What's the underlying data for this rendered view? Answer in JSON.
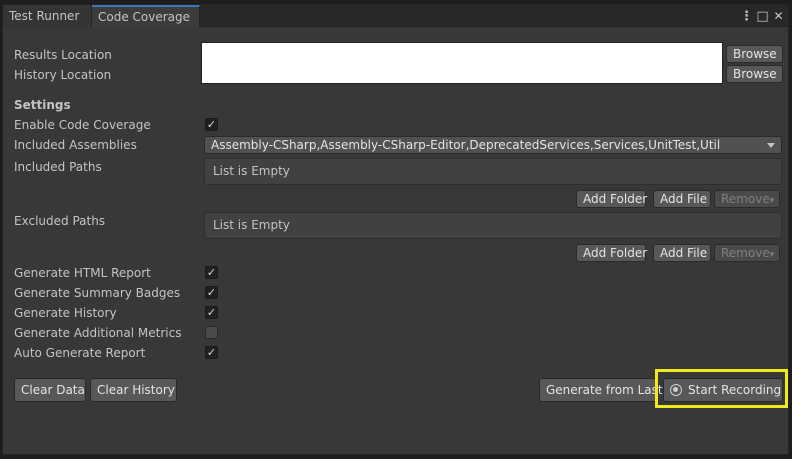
{
  "tabs": [
    {
      "label": "Test Runner",
      "active": false
    },
    {
      "label": "Code Coverage",
      "active": true
    }
  ],
  "window_controls": {
    "menu_icon": "kebab-menu-icon",
    "maximize_icon": "maximize-icon",
    "close_icon": "close-icon",
    "close_glyph": "✕",
    "maximize_glyph": "□",
    "menu_glyph": "⋮"
  },
  "locations": {
    "results_label": "Results Location",
    "history_label": "History Location",
    "browse_label": "Browse",
    "results_value": "",
    "history_value": ""
  },
  "settings": {
    "heading": "Settings",
    "enable_code_coverage_label": "Enable Code Coverage",
    "enable_code_coverage": true,
    "included_assemblies_label": "Included Assemblies",
    "included_assemblies_value": "Assembly-CSharp,Assembly-CSharp-Editor,DeprecatedServices,Services,UnitTest,Util",
    "included_paths_label": "Included Paths",
    "excluded_paths_label": "Excluded Paths",
    "list_empty_text": "List is Empty",
    "add_folder_label": "Add Folder",
    "add_file_label": "Add File",
    "remove_label": "Remove",
    "remove_arrow": "▾"
  },
  "report_options": [
    {
      "label": "Generate HTML Report",
      "checked": true
    },
    {
      "label": "Generate Summary Badges",
      "checked": true
    },
    {
      "label": "Generate History",
      "checked": true
    },
    {
      "label": "Generate Additional Metrics",
      "checked": false
    },
    {
      "label": "Auto Generate Report",
      "checked": true
    }
  ],
  "check_glyph": "✓",
  "footer": {
    "clear_data_label": "Clear Data",
    "clear_history_label": "Clear History",
    "generate_from_last_label": "Generate from Last",
    "start_recording_label": "Start Recording"
  },
  "colors": {
    "highlight": "#f0ea1a",
    "active_tab_accent": "#3a79bb"
  }
}
